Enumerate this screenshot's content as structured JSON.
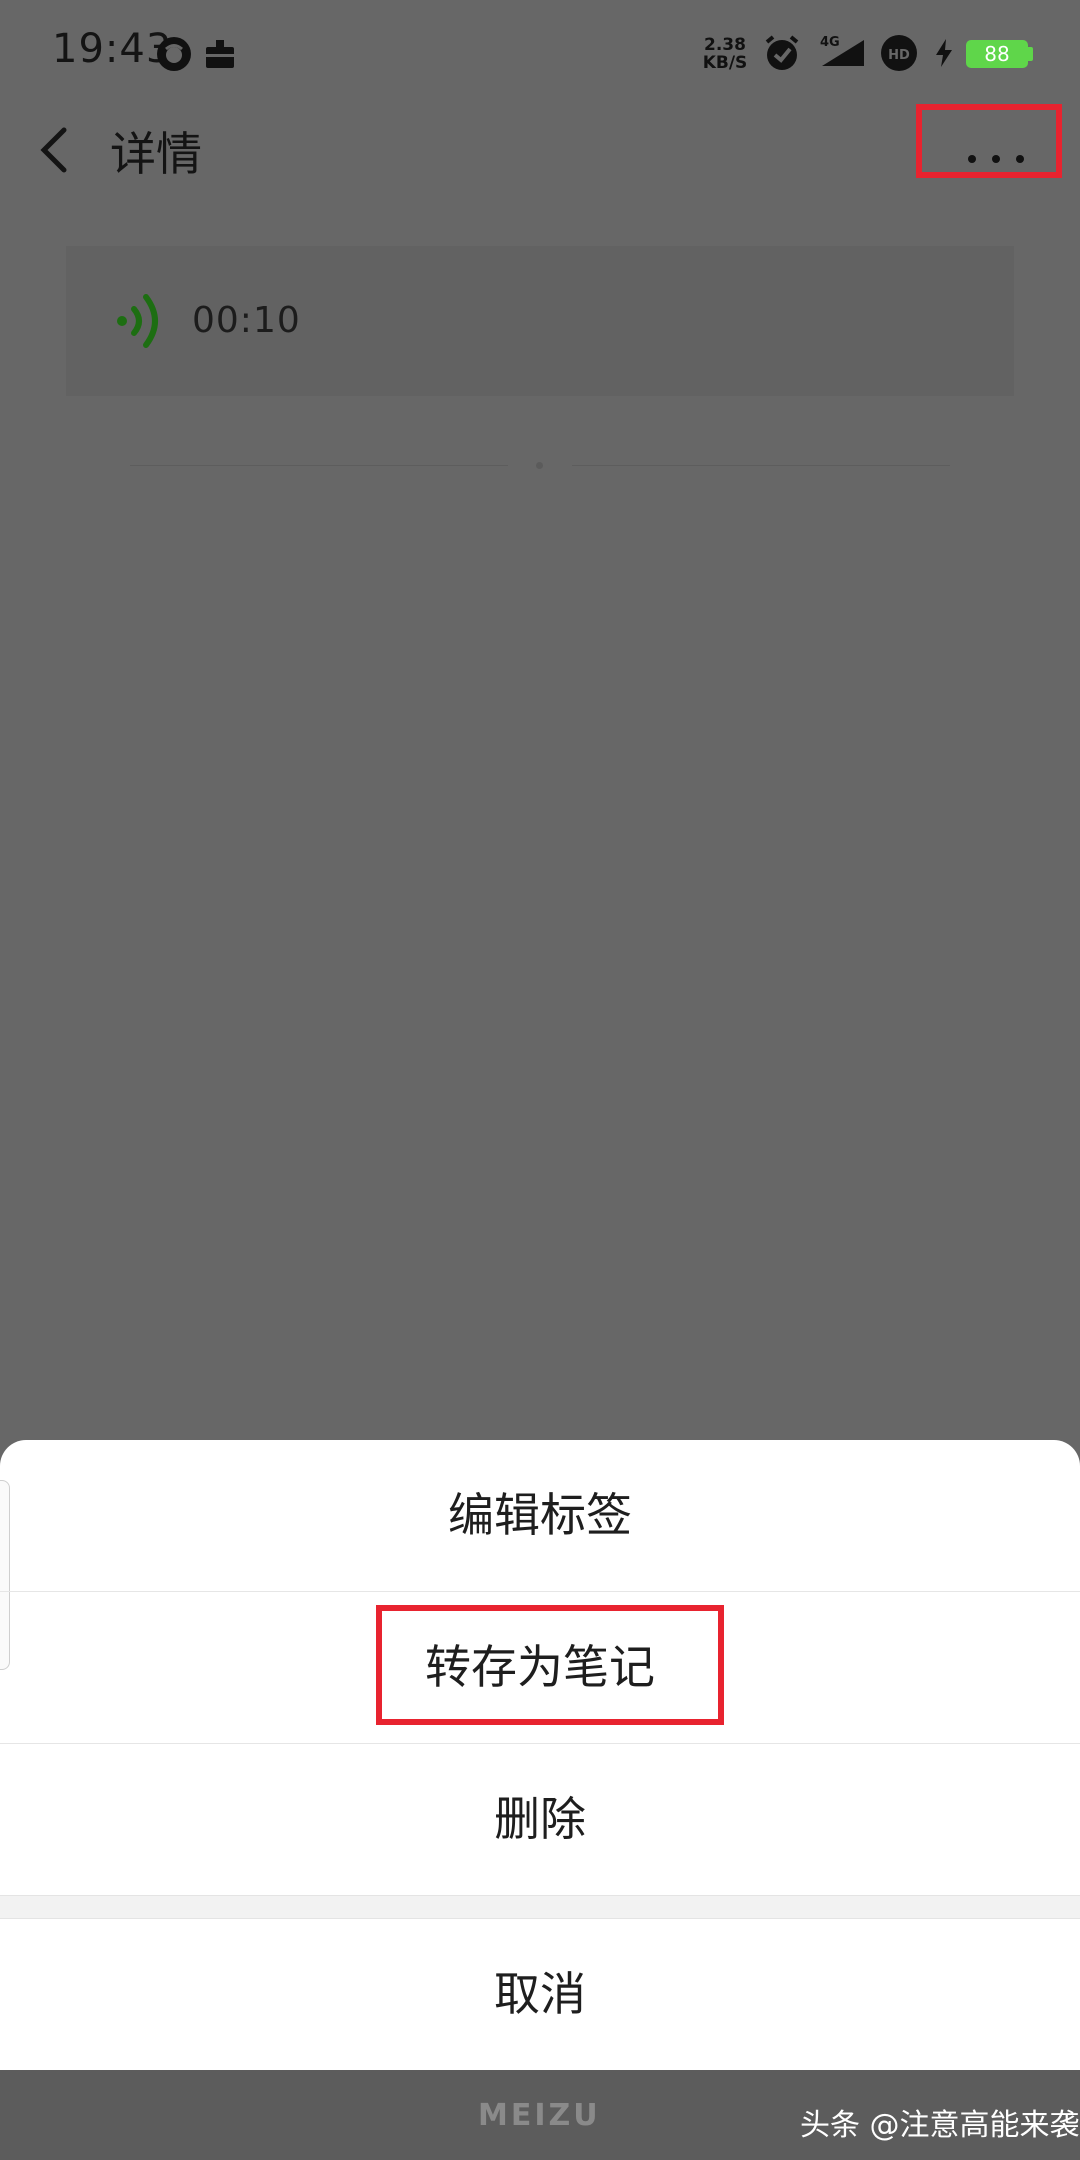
{
  "status_bar": {
    "time": "19:43",
    "net_speed_value": "2.38",
    "net_speed_unit": "KB/S",
    "network": "4G",
    "hd_label": "HD",
    "battery": "88",
    "icons": [
      "app-notification-icon",
      "briefcase-icon",
      "alarm-icon",
      "signal-icon",
      "hd-voice-icon",
      "charging-icon",
      "battery-icon"
    ]
  },
  "header": {
    "back_icon": "chevron-left-icon",
    "title": "详情",
    "more_icon": "more-horizontal-icon"
  },
  "voice_note": {
    "icon": "voice-playback-icon",
    "duration": "00:10",
    "accent_color": "#1d6e12"
  },
  "action_sheet": {
    "items": [
      {
        "label": "编辑标签"
      },
      {
        "label": "转存为笔记"
      },
      {
        "label": "删除"
      }
    ],
    "cancel_label": "取消"
  },
  "footer": {
    "brand": "MEIZU",
    "watermark": "头条 @注意高能来袭"
  },
  "colors": {
    "overlay": "#676767",
    "highlight": "#e8232f",
    "battery": "#5fd64a"
  }
}
